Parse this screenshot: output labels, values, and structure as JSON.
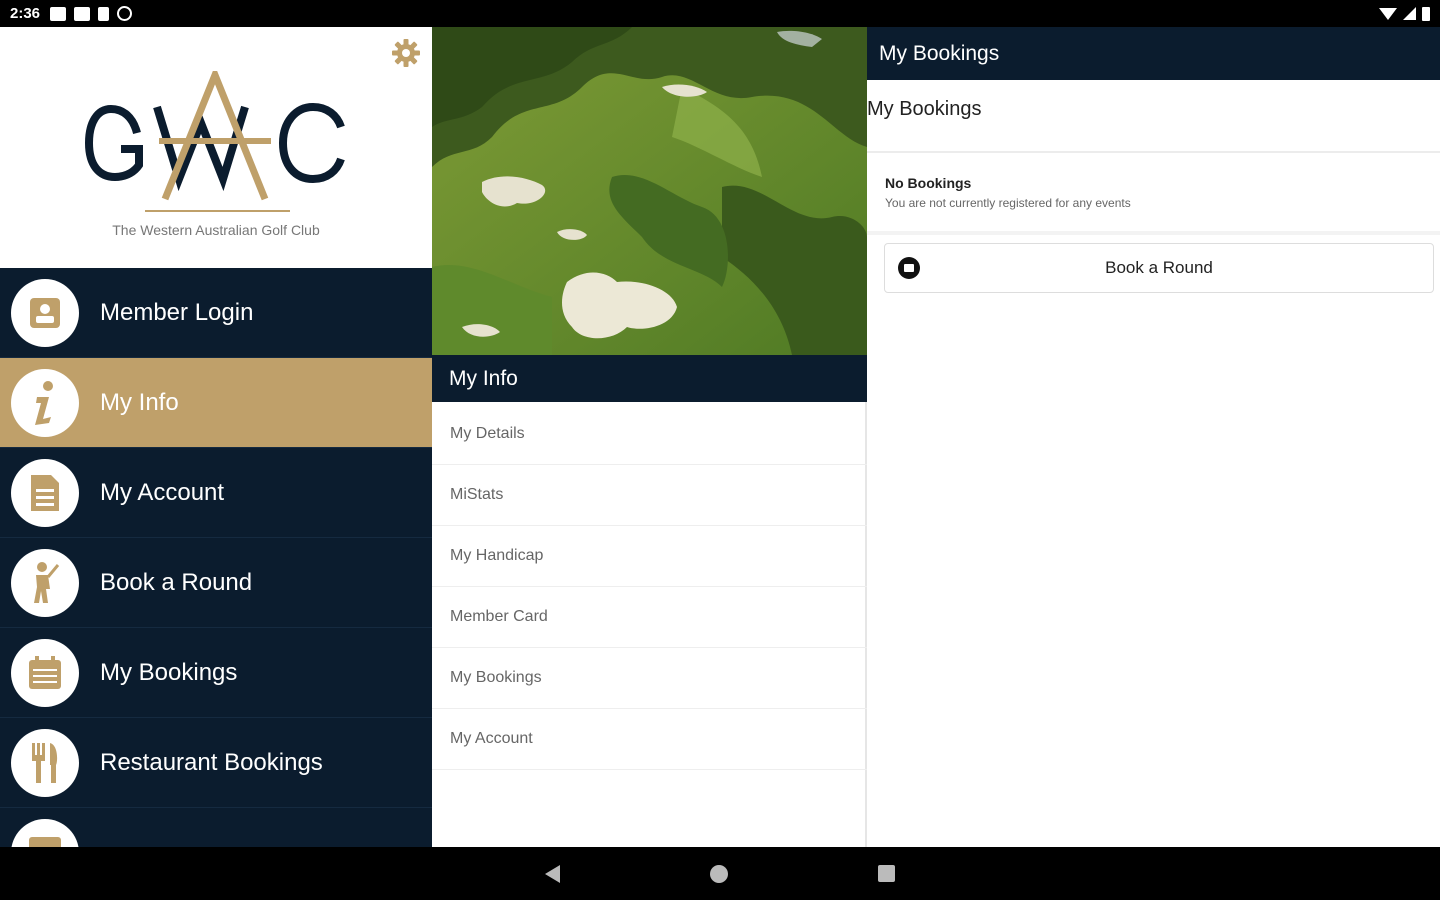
{
  "status_bar": {
    "time": "2:36"
  },
  "drawer": {
    "logo_subtitle": "The Western Australian Golf Club",
    "items": [
      {
        "label": "Member Login",
        "icon": "member-card-icon",
        "active": false
      },
      {
        "label": "My Info",
        "icon": "info-icon",
        "active": true
      },
      {
        "label": "My Account",
        "icon": "document-icon",
        "active": false
      },
      {
        "label": "Book a Round",
        "icon": "golfer-icon",
        "active": false
      },
      {
        "label": "My Bookings",
        "icon": "calendar-icon",
        "active": false
      },
      {
        "label": "Restaurant Bookings",
        "icon": "cutlery-icon",
        "active": false
      },
      {
        "label": "",
        "icon": "more-icon",
        "active": false
      }
    ]
  },
  "my_info": {
    "title": "My Info",
    "items": [
      "My Details",
      "MiStats",
      "My Handicap",
      "Member Card",
      "My Bookings",
      "My Account"
    ]
  },
  "bookings": {
    "header_title": "My Bookings",
    "subtitle": "My Bookings",
    "empty_title": "No Bookings",
    "empty_text": "You are not currently registered for any events",
    "book_button_label": "Book a Round"
  },
  "colors": {
    "navy": "#0b1c2e",
    "gold": "#bfa06a"
  }
}
